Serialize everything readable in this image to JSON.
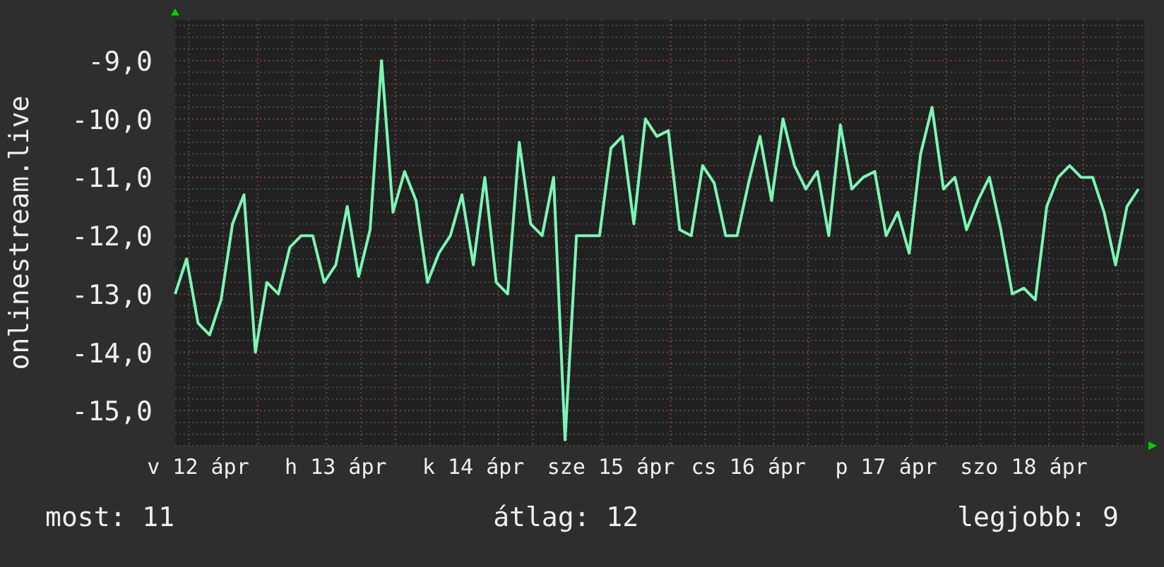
{
  "chart": {
    "chart_data": {
      "type": "line",
      "ylabel": "onlinestream.live",
      "categories": [
        null,
        null,
        "v 12 ápr",
        null,
        null,
        null,
        null,
        null,
        null,
        null,
        null,
        null,
        null,
        null,
        "h 13 ápr",
        null,
        null,
        null,
        null,
        null,
        null,
        null,
        null,
        null,
        null,
        null,
        "k 14 ápr",
        null,
        null,
        null,
        null,
        null,
        null,
        null,
        null,
        null,
        null,
        null,
        "sze 15 ápr",
        null,
        null,
        null,
        null,
        null,
        null,
        null,
        null,
        null,
        null,
        null,
        "cs 16 ápr",
        null,
        null,
        null,
        null,
        null,
        null,
        null,
        null,
        null,
        null,
        null,
        "p 17 ápr",
        null,
        null,
        null,
        null,
        null,
        null,
        null,
        null,
        null,
        null,
        null,
        "szo 18 ápr",
        null,
        null,
        null,
        null,
        null,
        null,
        null,
        null,
        null,
        null
      ],
      "series": [
        {
          "color": "#7df5b4",
          "values": [
            -13.0,
            -12.4,
            -13.5,
            -13.7,
            -13.1,
            -11.8,
            -11.3,
            -14.0,
            -12.8,
            -13.0,
            -12.2,
            -12.0,
            -12.0,
            -12.8,
            -12.5,
            -11.5,
            -12.7,
            -11.9,
            -9.0,
            -11.6,
            -10.9,
            -11.4,
            -12.8,
            -12.3,
            -12.0,
            -11.3,
            -12.5,
            -11.0,
            -12.8,
            -13.0,
            -10.4,
            -11.8,
            -12.0,
            -11.0,
            -15.5,
            -12.0,
            -12.0,
            -12.0,
            -10.5,
            -10.3,
            -11.8,
            -10.0,
            -10.3,
            -10.2,
            -11.9,
            -12.0,
            -10.8,
            -11.1,
            -12.0,
            -12.0,
            -11.1,
            -10.3,
            -11.4,
            -10.0,
            -10.8,
            -11.2,
            -10.9,
            -12.0,
            -10.1,
            -11.2,
            -11.0,
            -10.9,
            -12.0,
            -11.6,
            -12.3,
            -10.6,
            -9.8,
            -11.2,
            -11.0,
            -11.9,
            -11.4,
            -11.0,
            -11.9,
            -13.0,
            -12.9,
            -13.1,
            -11.5,
            -11.0,
            -10.8,
            -11.0,
            -11.0,
            -11.6,
            -12.5,
            -11.5,
            -11.2
          ]
        }
      ],
      "grid": true,
      "ylim": [
        -15.6,
        -8.3
      ],
      "yticks": [
        {
          "value": -9,
          "label": "-9,0"
        },
        {
          "value": -10,
          "label": "-10,0"
        },
        {
          "value": -11,
          "label": "-11,0"
        },
        {
          "value": -12,
          "label": "-12,0"
        },
        {
          "value": -13,
          "label": "-13,0"
        },
        {
          "value": -14,
          "label": "-14,0"
        },
        {
          "value": -15,
          "label": "-15,0"
        }
      ]
    }
  },
  "legend": [
    {
      "text": "most: 11"
    },
    {
      "text": "átlag: 12"
    },
    {
      "text": "legjobb: 9"
    }
  ]
}
